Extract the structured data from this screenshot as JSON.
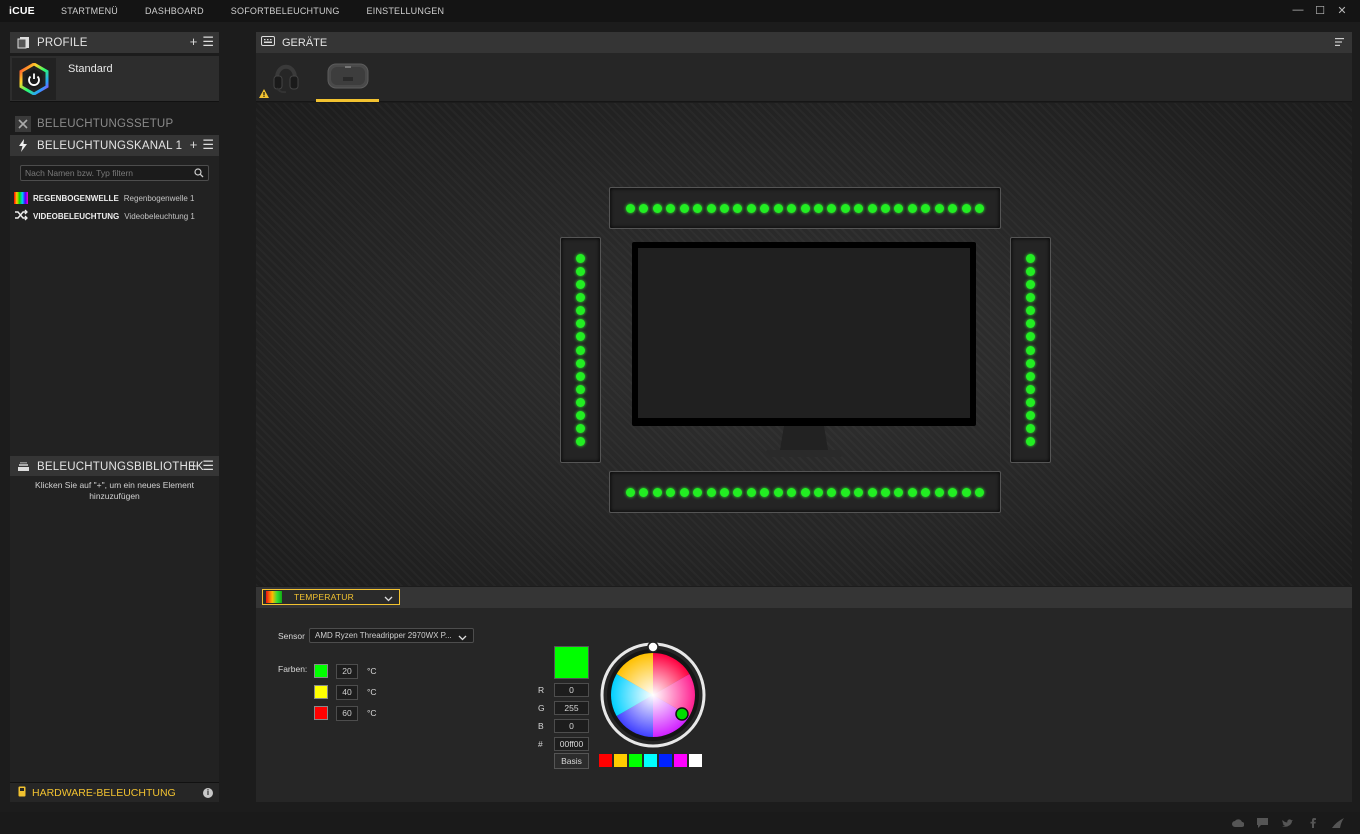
{
  "app": {
    "logo": "iCUE"
  },
  "nav": [
    "STARTMENÜ",
    "DASHBOARD",
    "SOFORTBELEUCHTUNG",
    "EINSTELLUNGEN"
  ],
  "window_controls": {
    "minimize": "—",
    "maximize": "☐",
    "close": "✕"
  },
  "profiles": {
    "title": "PROFILE",
    "current": "Standard"
  },
  "lighting_setup": {
    "title": "BELEUCHTUNGSSETUP"
  },
  "lighting_channel": {
    "title": "BELEUCHTUNGSKANAL 1",
    "filter_placeholder": "Nach Namen bzw. Typ filtern",
    "layers": [
      {
        "type": "REGENBOGENWELLE",
        "name": "Regenbogenwelle 1",
        "icon": "rainbow-icon"
      },
      {
        "type": "VIDEOBELEUCHTUNG",
        "name": "Videobeleuchtung 1",
        "icon": "shuffle-icon"
      }
    ]
  },
  "lighting_library": {
    "title": "BELEUCHTUNGSBIBLIOTHEK",
    "hint": "Klicken Sie auf \"+\", um ein neues Element hinzuzufügen"
  },
  "hardware_lighting": {
    "title": "HARDWARE-BELEUCHTUNG"
  },
  "devices": {
    "title": "GERÄTE",
    "tabs": [
      "headset",
      "hub"
    ],
    "active_tab": 1,
    "warning_on_tab": 0
  },
  "preview": {
    "led_color": "#22ee22",
    "top_strip_leds": 27,
    "bottom_strip_leds": 27,
    "left_strip_leds": 15,
    "right_strip_leds": 15
  },
  "effect": {
    "selected": "TEMPERATUR",
    "sensor_label": "Sensor",
    "sensor_value": "AMD Ryzen Threadripper 2970WX P...",
    "colors_label": "Farben:",
    "colors": [
      {
        "color": "#00ff00",
        "temp": "20",
        "unit": "°C"
      },
      {
        "color": "#ffff00",
        "temp": "40",
        "unit": "°C"
      },
      {
        "color": "#ff0000",
        "temp": "60",
        "unit": "°C"
      }
    ]
  },
  "color_picker": {
    "current": "#00ff00",
    "r_label": "R",
    "r": "0",
    "g_label": "G",
    "g": "255",
    "b_label": "B",
    "b": "0",
    "hex_label": "#",
    "hex": "00ff00",
    "basis_label": "Basis",
    "presets": [
      "#ff0000",
      "#ffcc00",
      "#00ff00",
      "#00ffff",
      "#0022ff",
      "#ff00ff",
      "#ffffff"
    ]
  },
  "footer_icons": [
    "cloud-icon",
    "chat-icon",
    "twitter-icon",
    "facebook-icon",
    "corsair-icon"
  ]
}
